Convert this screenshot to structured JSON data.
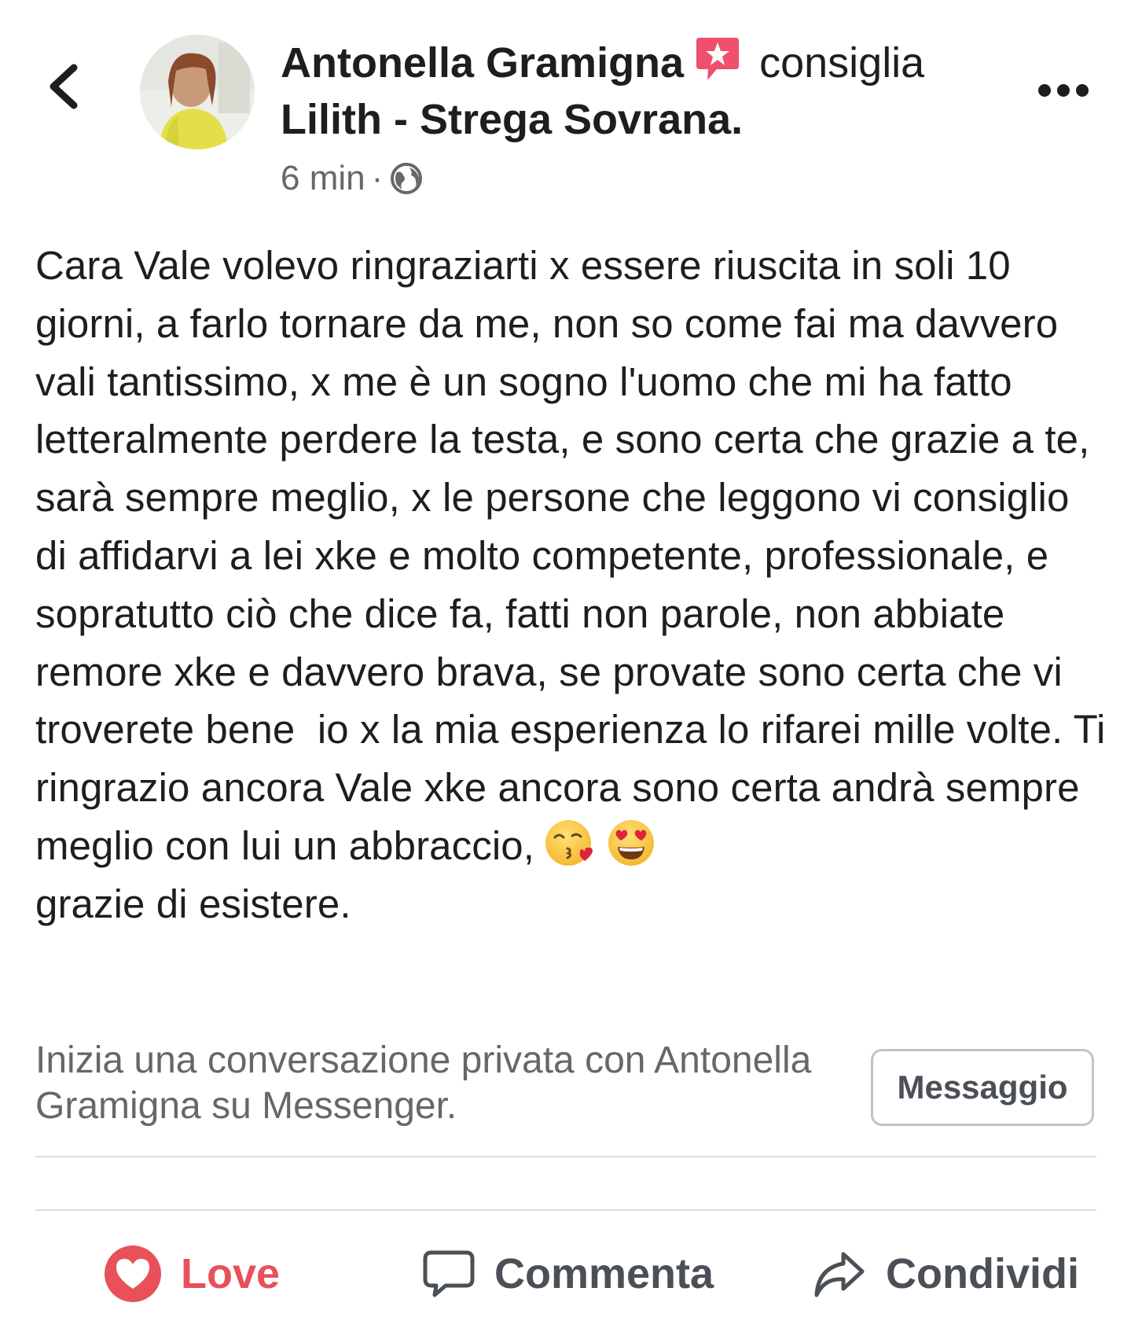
{
  "header": {
    "author_name": "Antonella Gramigna",
    "recommend_verb": "consiglia",
    "page_name": "Lilith - Strega Sovrana.",
    "timestamp": "6 min",
    "separator": "·",
    "audience_icon": "globe-icon",
    "recommend_icon": "recommendation-badge-icon",
    "back_icon": "chevron-left-icon",
    "more_icon": "more-dots-icon"
  },
  "post": {
    "text": "Cara Vale volevo ringraziarti x essere riuscita in soli 10 giorni, a farlo tornare da me, non so come fai ma davvero vali tantissimo, x me è un sogno l'uomo che mi ha fatto letteralmente perdere la testa, e sono certa che grazie a te, sarà sempre meglio, x le persone che leggono vi consiglio di affidarvi a lei xke e molto competente, professionale, e sopratutto ciò che dice fa, fatti non parole, non abbiate remore xke e davvero brava, se provate sono certa che vi troverete bene  io x la mia esperienza lo rifarei mille volte. Ti ringrazio ancora Vale xke ancora sono certa andrà sempre meglio con lui un abbraccio,",
    "text_end": "grazie di esistere.",
    "emojis": [
      "face-blowing-kiss-emoji",
      "heart-eyes-emoji"
    ]
  },
  "messenger": {
    "prompt": "Inizia una conversazione privata con Antonella Gramigna su Messenger.",
    "button_label": "Messaggio"
  },
  "actions": {
    "love_label": "Love",
    "comment_label": "Commenta",
    "share_label": "Condividi"
  },
  "colors": {
    "love": "#e8515a",
    "badge": "#f0506e",
    "text_primary": "#1c1e21",
    "text_secondary": "#65676b",
    "divider": "#dadde1"
  }
}
